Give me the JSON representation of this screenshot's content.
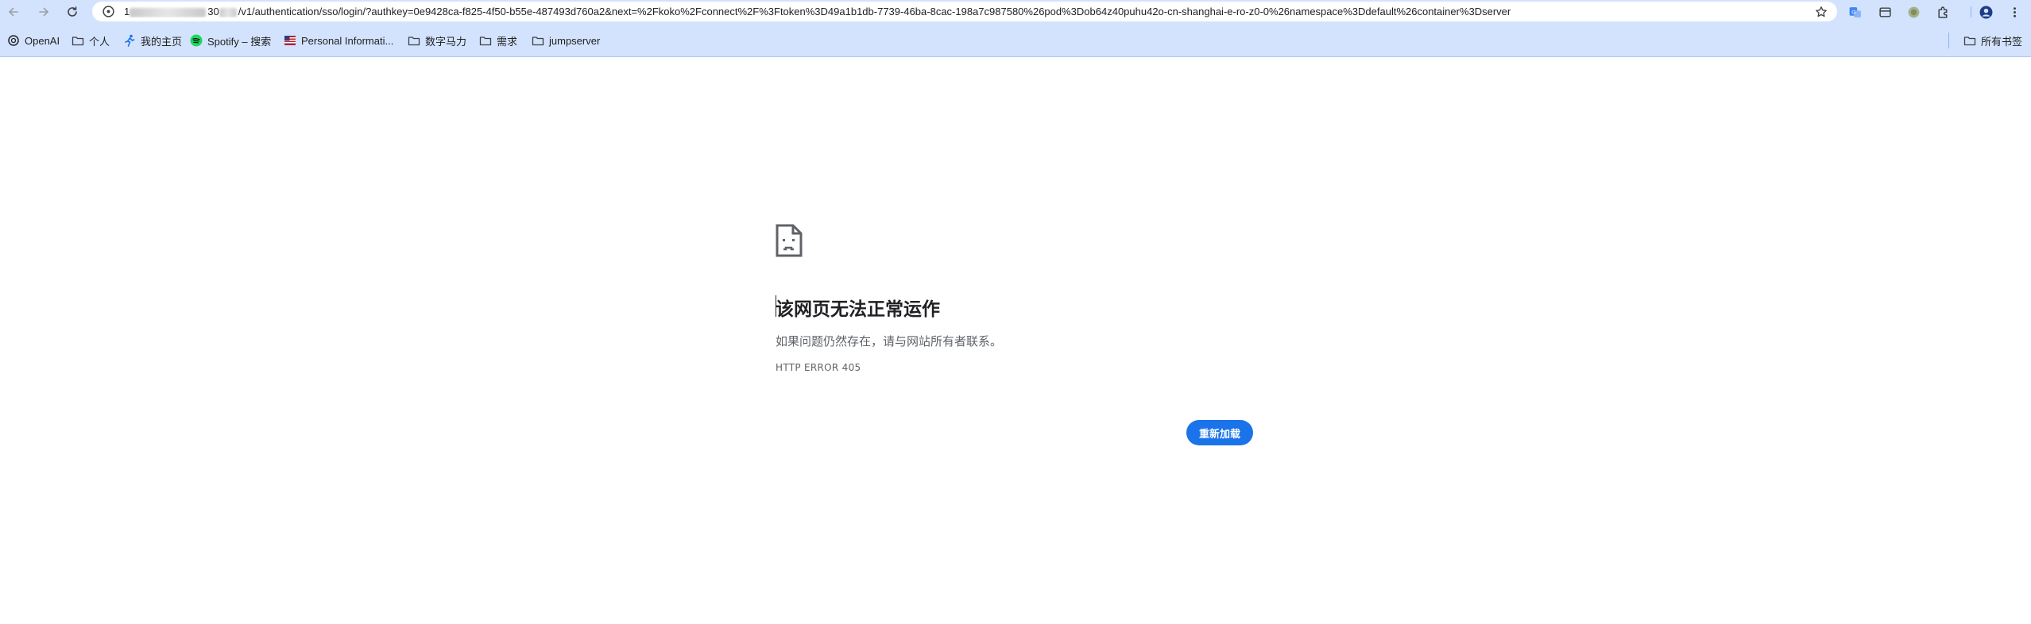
{
  "toolbar": {
    "url_host_prefix": "1",
    "url_host_suffix": "30",
    "url_path": "/v1/authentication/sso/login/?authkey=0e9428ca-f825-4f50-b55e-487493d760a2&next=%2Fkoko%2Fconnect%2F%3Ftoken%3D49a1b1db-7739-46ba-8cac-198a7c987580%26pod%3Dob64z40puhu42o-cn-shanghai-e-ro-z0-0%26namespace%3Ddefault%26container%3Dserver"
  },
  "bookmarks": {
    "items": [
      {
        "label": "OpenAI",
        "icon": "openai-icon"
      },
      {
        "label": "个人",
        "icon": "folder-icon"
      },
      {
        "label": "我的主页",
        "icon": "runner-icon"
      },
      {
        "label": "Spotify – 搜索",
        "icon": "spotify-icon"
      },
      {
        "label": "Personal Informati...",
        "icon": "flag-icon"
      },
      {
        "label": "数字马力",
        "icon": "folder-icon"
      },
      {
        "label": "需求",
        "icon": "folder-icon"
      },
      {
        "label": "jumpserver",
        "icon": "folder-icon"
      }
    ],
    "all_bookmarks": "所有书签"
  },
  "error": {
    "icon": "sad-page-icon",
    "title": "该网页无法正常运作",
    "message": "如果问题仍然存在，请与网站所有者联系。",
    "code": "HTTP ERROR 405",
    "reload_label": "重新加载"
  },
  "colors": {
    "chrome_bar": "#d3e3fd",
    "button_blue": "#1a73e8"
  }
}
